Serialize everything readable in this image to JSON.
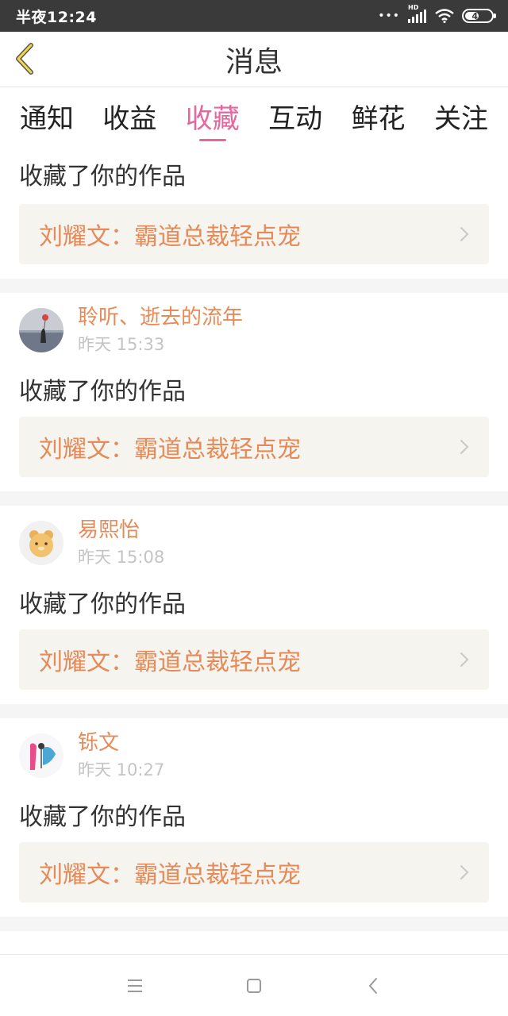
{
  "status_bar": {
    "time": "半夜12:24",
    "network_label": "HD",
    "battery": "45",
    "icons": [
      "dots-icon",
      "signal-icon",
      "wifi-icon",
      "battery-icon"
    ]
  },
  "header": {
    "title": "消息",
    "back_icon": "chevron-left-icon"
  },
  "tabs": [
    {
      "label": "通知",
      "active": false
    },
    {
      "label": "收益",
      "active": false
    },
    {
      "label": "收藏",
      "active": true
    },
    {
      "label": "互动",
      "active": false
    },
    {
      "label": "鲜花",
      "active": false
    },
    {
      "label": "关注",
      "active": false
    }
  ],
  "items": [
    {
      "user": "",
      "time": "",
      "action": "收藏了你的作品",
      "work": "刘耀文：霸道总裁轻点宠"
    },
    {
      "user": "聆听、逝去的流年",
      "time": "昨天 15:33",
      "action": "收藏了你的作品",
      "work": "刘耀文：霸道总裁轻点宠"
    },
    {
      "user": "易熙怡",
      "time": "昨天 15:08",
      "action": "收藏了你的作品",
      "work": "刘耀文：霸道总裁轻点宠"
    },
    {
      "user": "铄文",
      "time": "昨天 10:27",
      "action": "收藏了你的作品",
      "work": "刘耀文：霸道总裁轻点宠"
    }
  ],
  "navbar": {
    "icons": [
      "menu-icon",
      "home-square-icon",
      "back-triangle-icon"
    ]
  },
  "colors": {
    "accent": "#e7669e",
    "username": "#e58a58",
    "card_bg": "#f5f4ef",
    "back_arrow": "#f3d54a"
  }
}
